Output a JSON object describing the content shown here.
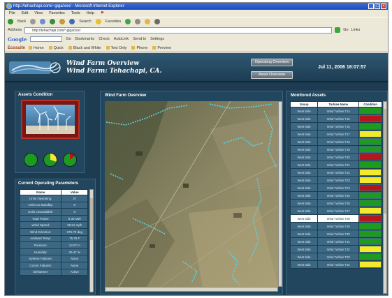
{
  "browser": {
    "window_title": "http://tehachapi.com/~giga/xxx/ - Microsoft Internet Explorer",
    "menu": [
      "File",
      "Edit",
      "View",
      "Favorites",
      "Tools",
      "Help"
    ],
    "toolbar": {
      "back": "Back",
      "search": "Search",
      "favorites": "Favorites"
    },
    "address_label": "Address",
    "address_value": "http://tehachapi.com/~giga/xxx/",
    "go_label": "Go",
    "links_label": "Links",
    "google_label": "Google",
    "google_items": [
      "Go",
      "Bookmarks",
      "Check",
      "AutoLink",
      "Send to",
      "Settings"
    ],
    "links_brand": "Ecosuite",
    "links_items": [
      "Home",
      "Quick",
      "Black and White",
      "Text Only",
      "Phone",
      "Preview"
    ]
  },
  "app": {
    "title_line1": "Wind Farm Overview",
    "title_line2": "Wind Farm: Tehachapi, CA.",
    "btn_top": "Operating Overview",
    "btn_bottom": "Asset Overview",
    "datetime": "Jul 11, 2006 16:07:57",
    "assets_panel_title": "Assets Condition",
    "params_panel_title": "Current Operating Parameters",
    "params_headers": [
      "Name",
      "Value"
    ],
    "params": [
      {
        "name": "Units Operating:",
        "value": "37"
      },
      {
        "name": "Units on Standby:",
        "value": "0"
      },
      {
        "name": "Units Unavailable:",
        "value": "0"
      },
      {
        "name": "Total Power:",
        "value": "9.30 MW"
      },
      {
        "name": "Wind Speed:",
        "value": "38.51 mph"
      },
      {
        "name": "Wind Direction:",
        "value": "279.78 deg"
      },
      {
        "name": "Ambient Temp:",
        "value": "75.78 F"
      },
      {
        "name": "Pressure:",
        "value": "13.07 in"
      },
      {
        "name": "Humidity:",
        "value": "29.47 %"
      },
      {
        "name": "System Failures:",
        "value": "None"
      },
      {
        "name": "Comm Failures:",
        "value": "None"
      },
      {
        "name": "OilAlarmer:",
        "value": "Active"
      }
    ],
    "map_panel_title": "Wind Farm Overview",
    "monitored_panel_title": "Monitored Assets",
    "monitored_headers": [
      "Group",
      "Turbine Name",
      "Condition"
    ],
    "monitored": [
      {
        "group": "West Side",
        "name": "Wind Turbine T14",
        "color": "#1e9a1e"
      },
      {
        "group": "West Side",
        "name": "Wind Turbine T15",
        "color": "#b3161b"
      },
      {
        "group": "West Side",
        "name": "Wind Turbine T16",
        "color": "#1e9a1e"
      },
      {
        "group": "West Side",
        "name": "Wind Turbine T17",
        "color": "#f2ea2b"
      },
      {
        "group": "West Side",
        "name": "Wind Turbine T18",
        "color": "#1e9a1e"
      },
      {
        "group": "West Side",
        "name": "Wind Turbine T19",
        "color": "#1e9a1e"
      },
      {
        "group": "West Side",
        "name": "Wind Turbine T20",
        "color": "#b3161b"
      },
      {
        "group": "West Side",
        "name": "Wind Turbine T21",
        "color": "#1e9a1e"
      },
      {
        "group": "West Side",
        "name": "Wind Turbine T22",
        "color": "#f2ea2b"
      },
      {
        "group": "West Side",
        "name": "Wind Turbine T23",
        "color": "#f2ea2b"
      },
      {
        "group": "West Side",
        "name": "Wind Turbine T24",
        "color": "#b3161b"
      },
      {
        "group": "West Side",
        "name": "Wind Turbine T25",
        "color": "#1e9a1e"
      },
      {
        "group": "West Side",
        "name": "Wind Turbine T26",
        "color": "#1e9a1e"
      },
      {
        "group": "West Side",
        "name": "Wind Turbine T27",
        "color": "#f2ea2b"
      },
      {
        "group": "West Side",
        "name": "Wind Turbine T28",
        "color": "#b3161b",
        "selected": true
      },
      {
        "group": "West Side",
        "name": "Wind Turbine T29",
        "color": "#1e9a1e"
      },
      {
        "group": "West Side",
        "name": "Wind Turbine T30",
        "color": "#1e9a1e"
      },
      {
        "group": "West Side",
        "name": "Wind Turbine T31",
        "color": "#1e9a1e"
      },
      {
        "group": "West Side",
        "name": "Wind Turbine T32",
        "color": "#f2ea2b"
      },
      {
        "group": "West Side",
        "name": "Wind Turbine T33",
        "color": "#1e9a1e"
      },
      {
        "group": "West Side",
        "name": "Wind Turbine T34",
        "color": "#f2ea2b"
      }
    ],
    "pies": [
      {
        "fill": "#1e9a1e",
        "slice_color": "#1e9a1e",
        "slice_pct": 0
      },
      {
        "fill": "#1e9a1e",
        "slice_color": "#f2ea2b",
        "slice_pct": 30
      },
      {
        "fill": "#1e9a1e",
        "slice_color": "#b3161b",
        "slice_pct": 14
      }
    ]
  }
}
